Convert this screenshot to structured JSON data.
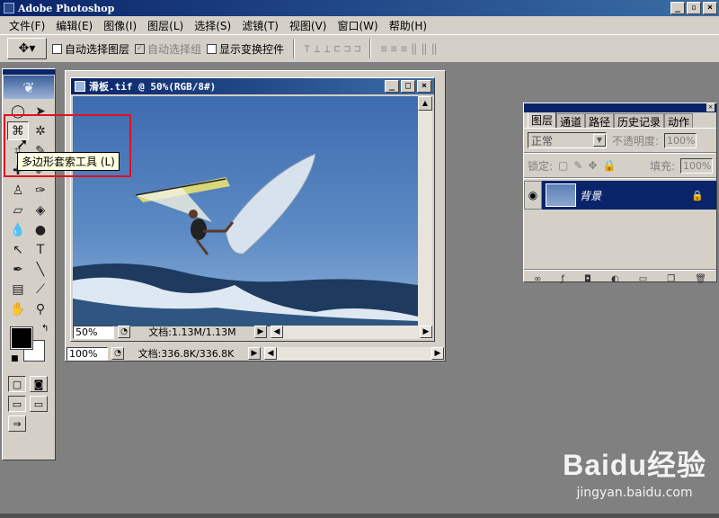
{
  "app": {
    "title": "Adobe Photoshop"
  },
  "menu": [
    "文件(F)",
    "编辑(E)",
    "图像(I)",
    "图层(L)",
    "选择(S)",
    "滤镜(T)",
    "视图(V)",
    "窗口(W)",
    "帮助(H)"
  ],
  "options": {
    "auto_select_layer": "自动选择图层",
    "auto_select_group": "自动选择组",
    "show_transform": "显示变换控件"
  },
  "tooltip": "多边形套索工具 (L)",
  "document": {
    "title": "滑板.tif @ 50%(RGB/8#)",
    "zoom": "50%",
    "doc_size": "文档:1.13M/1.13M"
  },
  "outer_window": {
    "zoom": "100%",
    "doc_size": "文档:336.8K/336.8K"
  },
  "layers_panel": {
    "tabs": [
      "图层",
      "通道",
      "路径",
      "历史记录",
      "动作"
    ],
    "blend_mode": "正常",
    "opacity_label": "不透明度:",
    "opacity_value": "100%",
    "lock_label": "锁定:",
    "fill_label": "填充:",
    "fill_value": "100%",
    "layer_name": "背景"
  },
  "watermark": {
    "logo": "Baidu经验",
    "url": "jingyan.baidu.com"
  }
}
